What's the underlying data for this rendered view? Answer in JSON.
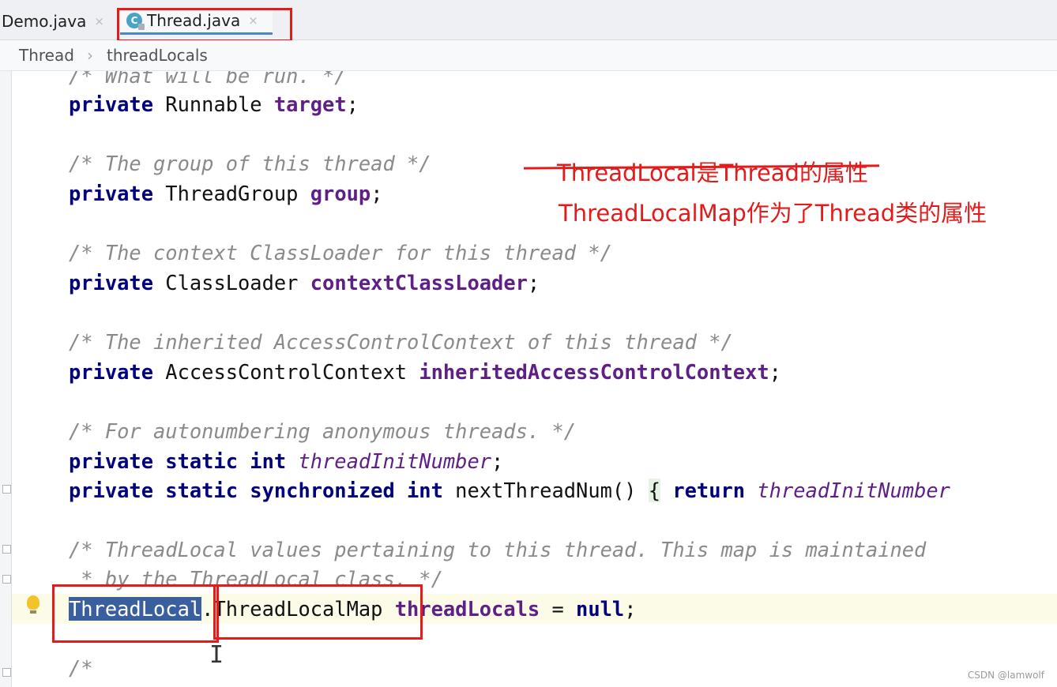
{
  "tabs": [
    {
      "label": "Demo.java",
      "close": "×"
    },
    {
      "label": "Thread.java",
      "close": "×",
      "icon_letter": "C",
      "icon": "java-class-icon"
    }
  ],
  "breadcrumb": {
    "items": [
      "Thread",
      "threadLocals"
    ],
    "separator": "›"
  },
  "code": {
    "l0": "/* What will be run. */",
    "l1_kw": "private",
    "l1_type": " Runnable ",
    "l1_field": "target",
    "l1_end": ";",
    "l2": "/* The group of this thread */",
    "l3_kw": "private",
    "l3_type": " ThreadGroup ",
    "l3_field": "group",
    "l3_end": ";",
    "l4": "/* The context ClassLoader for this thread */",
    "l5_kw": "private",
    "l5_type": " ClassLoader ",
    "l5_field": "contextClassLoader",
    "l5_end": ";",
    "l6": "/* The inherited AccessControlContext of this thread */",
    "l7_kw": "private",
    "l7_type": " AccessControlContext ",
    "l7_field": "inheritedAccessControlContext",
    "l7_end": ";",
    "l8": "/* For autonumbering anonymous threads. */",
    "l9_kw": "private static int",
    "l9_sp": " ",
    "l9_field": "threadInitNumber",
    "l9_end": ";",
    "l10_kw": "private static synchronized int",
    "l10_name": " nextThreadNum() ",
    "l10_brace": "{",
    "l10_sp": " ",
    "l10_ret": "return",
    "l10_sp2": " ",
    "l10_field": "threadInitNumber",
    "l11": "/* ThreadLocal values pertaining to this thread. This map is maintained",
    "l12": " * by the ThreadLocal class. */",
    "l13_sel": "ThreadLocal",
    "l13_type": ".ThreadLocalMap ",
    "l13_field": "threadLocals",
    "l13_eq": " = ",
    "l13_null": "null",
    "l13_end": ";",
    "l14": "/*"
  },
  "annotations": {
    "struck": "ThreadLocal是Thread的属性",
    "note": "ThreadLocalMap作为了Thread类的属性"
  },
  "watermark": "CSDN @lamwolf",
  "colors": {
    "annotation": "#e21b1b",
    "keyword": "#00007f",
    "field": "#5e1f86",
    "comment": "#8a8a8a",
    "selection": "#3a5f9e"
  }
}
